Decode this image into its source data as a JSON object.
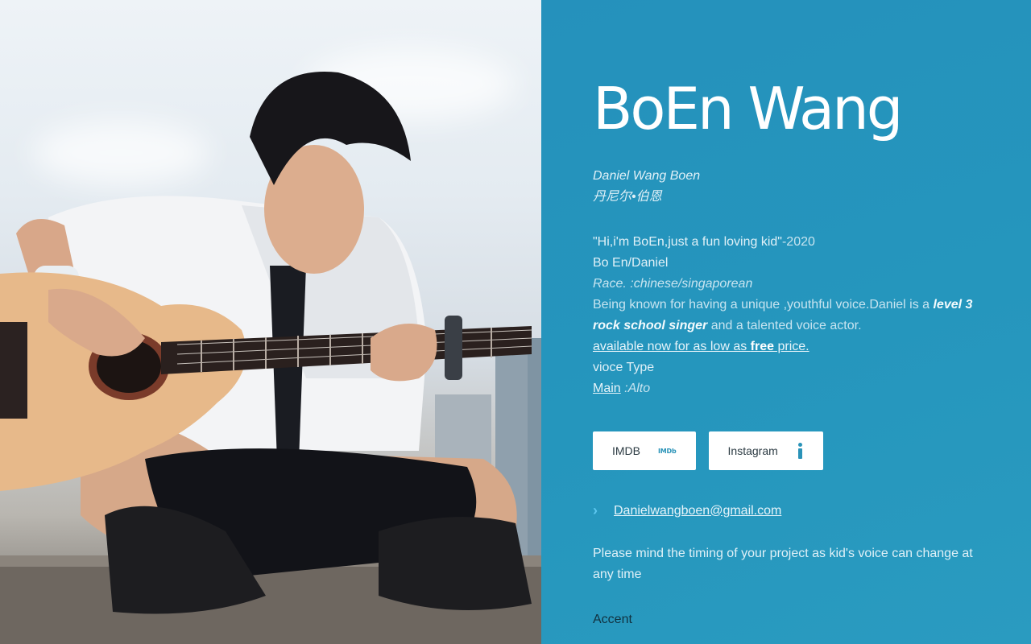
{
  "profile": {
    "name": "BoEn Wang",
    "alias_en": "Daniel Wang Boen",
    "alias_cn": "丹尼尔•伯恩"
  },
  "bio": {
    "quote": "\"Hi,i'm BoEn,just a fun loving kid\"",
    "quote_year": "-2020",
    "nickname": "Bo En/Daniel",
    "race": "Race. :chinese/singaporean",
    "desc_pre": "Being known for having a unique ,youthful voice.Daniel is a ",
    "desc_em": "level 3 rock school singer",
    "desc_post": " and a talented voice actor.",
    "avail_pre": "available now for as low as ",
    "avail_free": "free",
    "avail_post": " price.",
    "voice_type_label": "vioce Type",
    "voice_main": "Main",
    "voice_value": " :Alto"
  },
  "buttons": {
    "imdb_label": "IMDB",
    "imdb_icon_text": "IMDb",
    "instagram_label": "Instagram"
  },
  "contact": {
    "email": "Danielwangboen@gmail.com"
  },
  "note": "Please mind the timing of your project as kid's voice can change at any time",
  "accent_label": "Accent",
  "colors": {
    "panel": "#2596bd",
    "accent_icon": "#5cc7f0",
    "button_bg": "#ffffff"
  },
  "icons": {
    "email_bullet": "chevron-right-icon",
    "imdb": "imdb-icon",
    "instagram": "info-icon"
  }
}
